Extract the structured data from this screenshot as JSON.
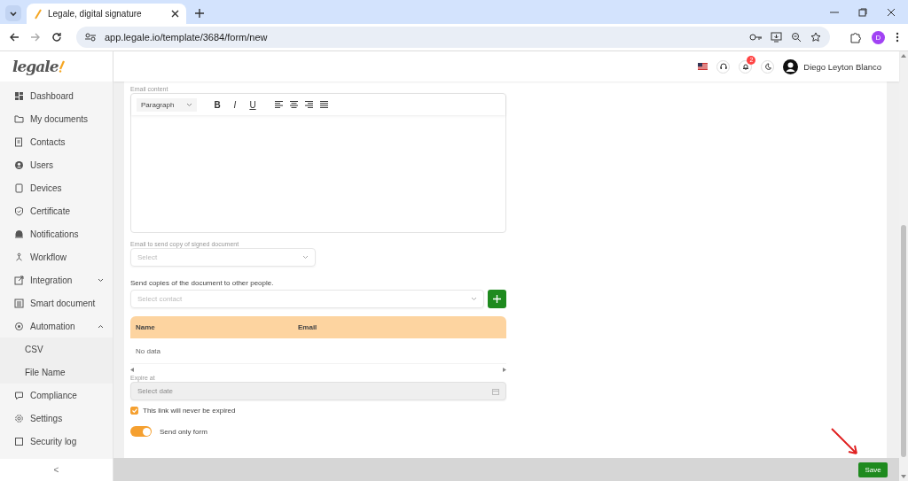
{
  "browser": {
    "tab_title": "Legale, digital signature",
    "url": "app.legale.io/template/3684/form/new",
    "profile_initial": "D"
  },
  "logo": "legale",
  "sidebar": {
    "items": [
      {
        "label": "Dashboard"
      },
      {
        "label": "My documents"
      },
      {
        "label": "Contacts"
      },
      {
        "label": "Users"
      },
      {
        "label": "Devices"
      },
      {
        "label": "Certificate"
      },
      {
        "label": "Notifications"
      },
      {
        "label": "Workflow"
      },
      {
        "label": "Integration",
        "expanded": false
      },
      {
        "label": "Smart document"
      },
      {
        "label": "Automation",
        "expanded": true,
        "children": [
          {
            "label": "CSV"
          },
          {
            "label": "File Name"
          }
        ]
      },
      {
        "label": "Compliance"
      },
      {
        "label": "Settings"
      },
      {
        "label": "Security log"
      }
    ],
    "collapse": "<"
  },
  "header": {
    "notification_count": "2",
    "user_name": "Diego Leyton Blanco"
  },
  "form": {
    "email_content": {
      "label": "Email content",
      "block_style": "Paragraph",
      "format_buttons": [
        "B",
        "I",
        "U"
      ]
    },
    "copy_email": {
      "label": "Email to send copy of signed document",
      "placeholder": "Select"
    },
    "send_copies": {
      "label": "Send copies of the document to other people.",
      "placeholder": "Select contact"
    },
    "table": {
      "columns": [
        "Name",
        "Email"
      ],
      "empty_text": "No data"
    },
    "expire": {
      "label": "Expire at",
      "placeholder": "Select date",
      "disabled": true
    },
    "never_expire": {
      "label": "This link will never be expired",
      "checked": true
    },
    "send_only_form": {
      "label": "Send only form",
      "on": true
    }
  },
  "save_button": "Save"
}
